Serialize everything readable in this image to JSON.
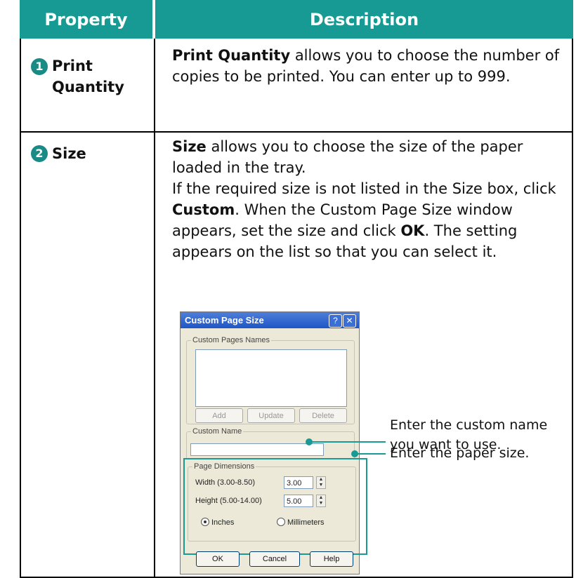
{
  "headers": {
    "property": "Property",
    "description": "Description"
  },
  "rows": [
    {
      "num": "1",
      "property": "Print Quantity",
      "desc_bold": "Print Quantity",
      "desc_rest": " allows you to choose the number of copies to be printed. You can enter up to 999."
    },
    {
      "num": "2",
      "property": "Size",
      "desc_bold": "Size",
      "desc_rest1": " allows you to choose the size of the paper loaded in the tray.",
      "desc_line2a": "If the required size is not listed in the Size box, click ",
      "desc_custom": "Custom",
      "desc_line2b": ". When the Custom Page Size window appears, set the size and click ",
      "desc_ok": "OK",
      "desc_line2c": ". The setting appears on the list so that you can select it."
    }
  ],
  "dialog": {
    "title": "Custom Page Size",
    "help_btn": "?",
    "close_btn": "✕",
    "names_group": "Custom Pages Names",
    "add": "Add",
    "update": "Update",
    "delete": "Delete",
    "name_group": "Custom Name",
    "dims_group": "Page Dimensions",
    "width_label": "Width (3.00-8.50)",
    "width_value": "3.00",
    "height_label": "Height (5.00-14.00)",
    "height_value": "5.00",
    "inches": "Inches",
    "millimeters": "Millimeters",
    "ok": "OK",
    "cancel": "Cancel",
    "help": "Help"
  },
  "callouts": {
    "name": "Enter the custom name you want to use.",
    "size": "Enter the paper size."
  },
  "accent": "#179a93"
}
